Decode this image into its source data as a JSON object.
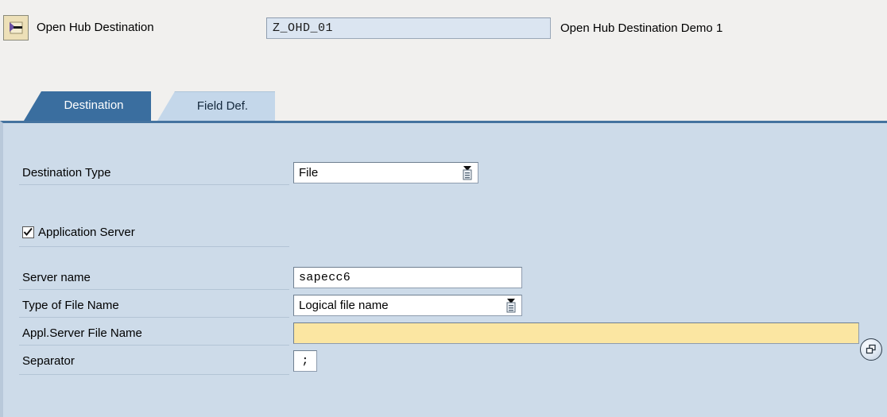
{
  "header": {
    "icon": "open-hub-destination-icon",
    "label": "Open Hub Destination",
    "key_value": "Z_OHD_01",
    "description": "Open Hub Destination Demo 1"
  },
  "tabs": [
    {
      "label": "Destination",
      "active": true
    },
    {
      "label": "Field Def.",
      "active": false
    }
  ],
  "form": {
    "destination_type": {
      "label": "Destination Type",
      "value": "File",
      "control": "dropdown"
    },
    "application_server": {
      "label": "Application Server",
      "checked": true
    },
    "server_name": {
      "label": "Server name",
      "value": "sapecc6"
    },
    "type_of_file_name": {
      "label": "Type of File Name",
      "value": "Logical file name",
      "control": "dropdown"
    },
    "appl_server_file_name": {
      "label": "Appl.Server File Name",
      "value": "",
      "required": true,
      "help_button": "multiple-selection-icon"
    },
    "separator": {
      "label": "Separator",
      "value": ";"
    }
  },
  "colors": {
    "page_background": "#f1f0ee",
    "panel_background": "#cddbe9",
    "tab_active": "#3a6e9f",
    "tab_inactive": "#c4d7ea",
    "required_field": "#fbe6a2",
    "readonly_field": "#dbe5f1"
  }
}
